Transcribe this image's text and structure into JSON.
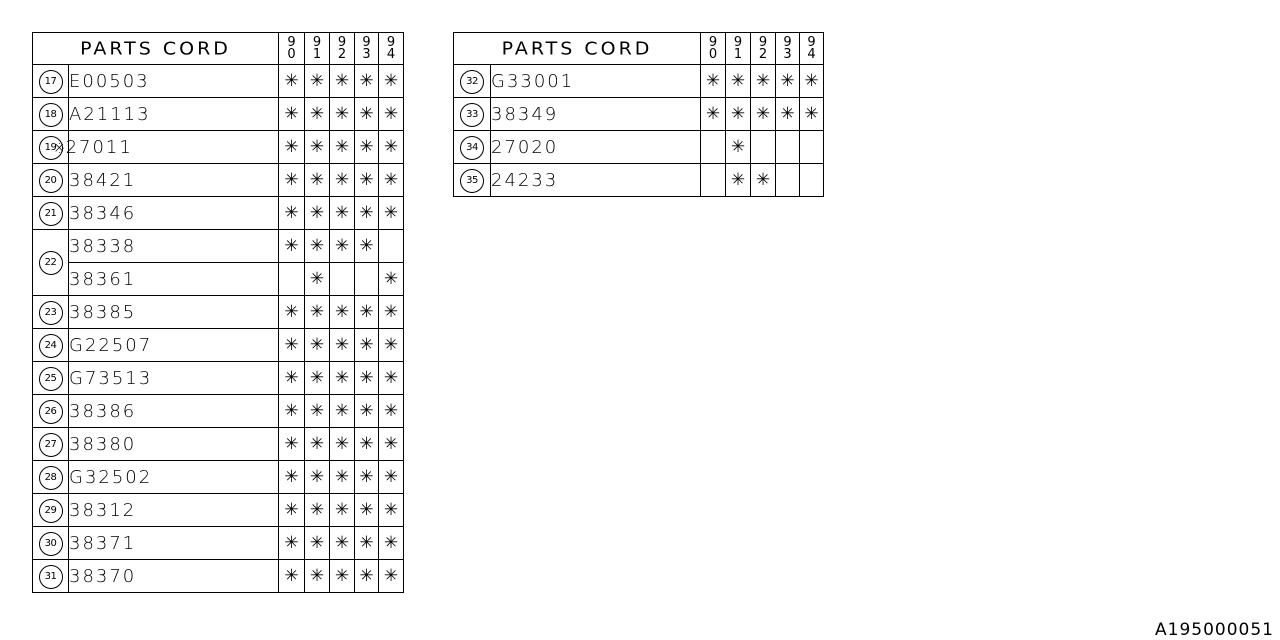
{
  "tables": [
    {
      "header": {
        "title": "PARTS CORD",
        "years": [
          [
            "9",
            "0"
          ],
          [
            "9",
            "1"
          ],
          [
            "9",
            "2"
          ],
          [
            "9",
            "3"
          ],
          [
            "9",
            "4"
          ]
        ]
      },
      "rows": [
        {
          "ref": "17",
          "code": "E00503",
          "note": "",
          "marks": [
            "*",
            "*",
            "*",
            "*",
            "*"
          ]
        },
        {
          "ref": "18",
          "code": "A21113",
          "note": "",
          "marks": [
            "*",
            "*",
            "*",
            "*",
            "*"
          ]
        },
        {
          "ref": "19",
          "code": "27011",
          "note": "※",
          "marks": [
            "*",
            "*",
            "*",
            "*",
            "*"
          ]
        },
        {
          "ref": "20",
          "code": "38421",
          "note": "",
          "marks": [
            "*",
            "*",
            "*",
            "*",
            "*"
          ]
        },
        {
          "ref": "21",
          "code": "38346",
          "note": "",
          "marks": [
            "*",
            "*",
            "*",
            "*",
            "*"
          ]
        },
        {
          "ref": "22",
          "code": "38338",
          "note": "",
          "marks": [
            "*",
            "*",
            "*",
            "*",
            ""
          ]
        },
        {
          "ref": "",
          "code": "38361",
          "note": "",
          "marks": [
            "",
            "*",
            "",
            "",
            "*"
          ]
        },
        {
          "ref": "23",
          "code": "38385",
          "note": "",
          "marks": [
            "*",
            "*",
            "*",
            "*",
            "*"
          ]
        },
        {
          "ref": "24",
          "code": "G22507",
          "note": "",
          "marks": [
            "*",
            "*",
            "*",
            "*",
            "*"
          ]
        },
        {
          "ref": "25",
          "code": "G73513",
          "note": "",
          "marks": [
            "*",
            "*",
            "*",
            "*",
            "*"
          ]
        },
        {
          "ref": "26",
          "code": "38386",
          "note": "",
          "marks": [
            "*",
            "*",
            "*",
            "*",
            "*"
          ]
        },
        {
          "ref": "27",
          "code": "38380",
          "note": "",
          "marks": [
            "*",
            "*",
            "*",
            "*",
            "*"
          ]
        },
        {
          "ref": "28",
          "code": "G32502",
          "note": "",
          "marks": [
            "*",
            "*",
            "*",
            "*",
            "*"
          ]
        },
        {
          "ref": "29",
          "code": "38312",
          "note": "",
          "marks": [
            "*",
            "*",
            "*",
            "*",
            "*"
          ]
        },
        {
          "ref": "30",
          "code": "38371",
          "note": "",
          "marks": [
            "*",
            "*",
            "*",
            "*",
            "*"
          ]
        },
        {
          "ref": "31",
          "code": "38370",
          "note": "",
          "marks": [
            "*",
            "*",
            "*",
            "*",
            "*"
          ]
        }
      ]
    },
    {
      "header": {
        "title": "PARTS CORD",
        "years": [
          [
            "9",
            "0"
          ],
          [
            "9",
            "1"
          ],
          [
            "9",
            "2"
          ],
          [
            "9",
            "3"
          ],
          [
            "9",
            "4"
          ]
        ]
      },
      "rows": [
        {
          "ref": "32",
          "code": "G33001",
          "note": "",
          "marks": [
            "*",
            "*",
            "*",
            "*",
            "*"
          ]
        },
        {
          "ref": "33",
          "code": "38349",
          "note": "",
          "marks": [
            "*",
            "*",
            "*",
            "*",
            "*"
          ]
        },
        {
          "ref": "34",
          "code": "27020",
          "note": "",
          "marks": [
            "",
            "*",
            "",
            "",
            ""
          ]
        },
        {
          "ref": "35",
          "code": "24233",
          "note": "",
          "marks": [
            "",
            "*",
            "*",
            "",
            ""
          ]
        }
      ]
    }
  ],
  "mark_glyph": "✳",
  "diagram_id": "A195000051"
}
